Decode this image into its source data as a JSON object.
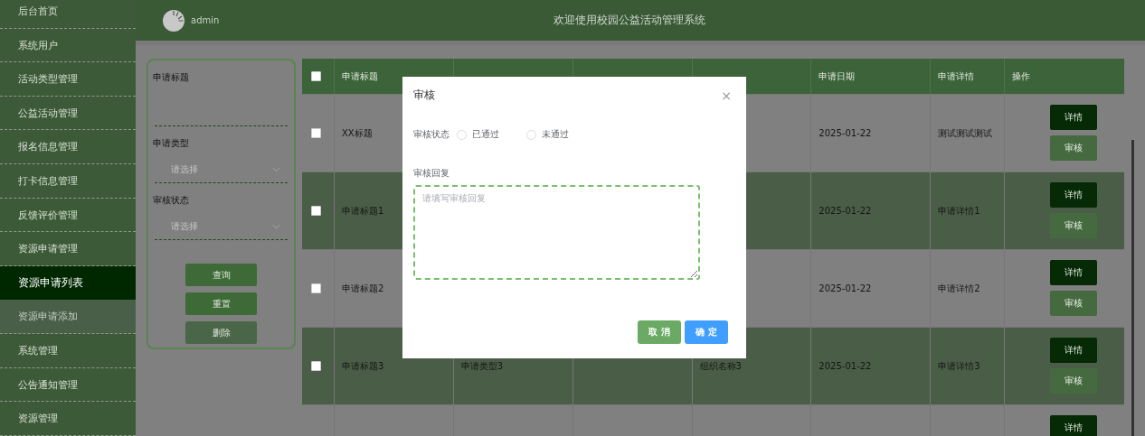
{
  "sidebar": {
    "items": [
      {
        "label": "后台首页",
        "selected": false,
        "hovered": false
      },
      {
        "label": "系统用户",
        "selected": false,
        "hovered": false
      },
      {
        "label": "活动类型管理",
        "selected": false,
        "hovered": false
      },
      {
        "label": "公益活动管理",
        "selected": false,
        "hovered": false
      },
      {
        "label": "报名信息管理",
        "selected": false,
        "hovered": false
      },
      {
        "label": "打卡信息管理",
        "selected": false,
        "hovered": false
      },
      {
        "label": "反馈评价管理",
        "selected": false,
        "hovered": false
      },
      {
        "label": "资源申请管理",
        "selected": false,
        "hovered": false
      },
      {
        "label": "资源申请列表",
        "selected": true,
        "hovered": false
      },
      {
        "label": "资源申请添加",
        "selected": false,
        "hovered": true
      },
      {
        "label": "系统管理",
        "selected": false,
        "hovered": false
      },
      {
        "label": "公告通知管理",
        "selected": false,
        "hovered": false
      },
      {
        "label": "资源管理",
        "selected": false,
        "hovered": false
      }
    ]
  },
  "header": {
    "user": "admin",
    "title": "欢迎使用校园公益活动管理系统"
  },
  "filters": {
    "fields": [
      {
        "kind": "text",
        "label": "申请标题"
      },
      {
        "kind": "select",
        "label": "申请类型",
        "placeholder": "请选择"
      },
      {
        "kind": "select",
        "label": "审核状态",
        "placeholder": "请选择"
      }
    ],
    "buttons": [
      {
        "label": "查询",
        "kind": "primary"
      },
      {
        "label": "重置",
        "kind": "primary"
      },
      {
        "label": "删除",
        "kind": "muted"
      }
    ]
  },
  "table": {
    "all_checked": false,
    "columns": [
      {
        "label": "申请标题"
      },
      {},
      {},
      {},
      {
        "label": "申请日期"
      },
      {
        "label": "申请详情"
      },
      {
        "label": "操作"
      }
    ],
    "rows": [
      {
        "checked": false,
        "cells": [
          "XX标题",
          null,
          null,
          null,
          "2025-01-22",
          "测试测试测试"
        ],
        "actions": [
          "详情",
          "审核"
        ]
      },
      {
        "checked": false,
        "cells": [
          "申请标题1",
          null,
          null,
          null,
          "2025-01-22",
          "申请详情1"
        ],
        "actions": [
          "详情",
          "审核"
        ]
      },
      {
        "checked": false,
        "cells": [
          "申请标题2",
          null,
          null,
          null,
          "2025-01-22",
          "申请详情2"
        ],
        "actions": [
          "详情",
          "审核"
        ]
      },
      {
        "checked": false,
        "cells": [
          "申请标题3",
          "申请类型3",
          null,
          "组织名称3",
          "2025-01-22",
          "申请详情3"
        ],
        "actions": [
          "详情",
          "审核"
        ]
      },
      {
        "cells": [
          null,
          null,
          null,
          null,
          null,
          null
        ],
        "actions": [
          "详情"
        ]
      }
    ]
  },
  "dialog": {
    "title": "审核",
    "close": "×",
    "status_label": "审核状态",
    "options": [
      {
        "label": "已通过",
        "selected": false
      },
      {
        "label": "未通过",
        "selected": false
      }
    ],
    "reply_label": "审核回复",
    "reply_placeholder": "请填写审核回复",
    "buttons": [
      {
        "label": "取 消",
        "kind": "cancel"
      },
      {
        "label": "确 定",
        "kind": "confirm"
      }
    ]
  }
}
